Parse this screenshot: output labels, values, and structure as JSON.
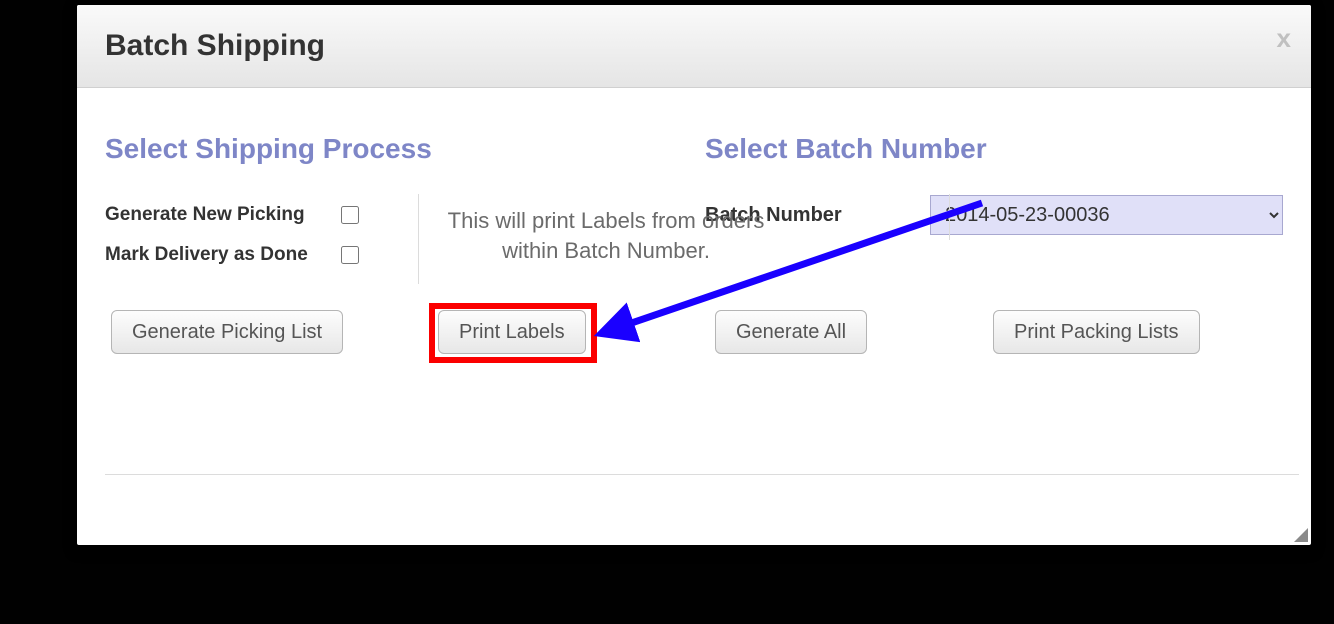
{
  "modal": {
    "title": "Batch Shipping",
    "close_glyph": "x"
  },
  "left": {
    "section_title": "Select Shipping Process",
    "option_generate": "Generate New Picking",
    "option_mark_done": "Mark Delivery as Done",
    "hint": "This will print Labels from orders within Batch Number."
  },
  "right": {
    "section_title": "Select Batch Number",
    "batch_label": "Batch Number",
    "batch_selected": "2014-05-23-00036"
  },
  "buttons": {
    "picking": "Generate Picking List",
    "labels": "Print Labels",
    "generate_all": "Generate All",
    "packing": "Print Packing Lists"
  }
}
